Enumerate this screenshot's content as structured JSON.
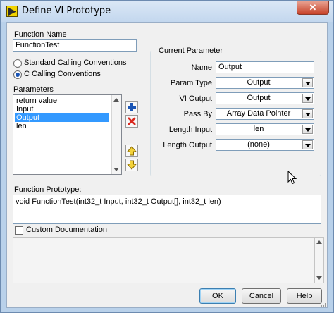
{
  "window": {
    "title": "Define VI Prototype",
    "close_label": "✕"
  },
  "function_name": {
    "label": "Function Name",
    "value": "FunctionTest"
  },
  "calling_conventions": {
    "options": [
      "Standard Calling Conventions",
      "C Calling Conventions"
    ],
    "selected": "C Calling Conventions"
  },
  "parameters": {
    "label": "Parameters",
    "items": [
      "return value",
      "Input",
      "Output",
      "len"
    ],
    "selected": "Output"
  },
  "current_parameter": {
    "title": "Current Parameter",
    "name_label": "Name",
    "name_value": "Output",
    "param_type_label": "Param Type",
    "param_type_value": "Output",
    "vi_output_label": "VI Output",
    "vi_output_value": "Output",
    "pass_by_label": "Pass By",
    "pass_by_value": "Array Data Pointer",
    "length_input_label": "Length Input",
    "length_input_value": "len",
    "length_output_label": "Length Output",
    "length_output_value": "(none)"
  },
  "prototype": {
    "label": "Function Prototype:",
    "value": "void FunctionTest(int32_t Input, int32_t Output[], int32_t len)"
  },
  "custom_documentation": {
    "label": "Custom Documentation",
    "checked": false
  },
  "buttons": {
    "ok": "OK",
    "cancel": "Cancel",
    "help": "Help"
  },
  "colors": {
    "accent_blue": "#1a55b5",
    "selection": "#3399ff",
    "delete_red": "#d9261c"
  }
}
